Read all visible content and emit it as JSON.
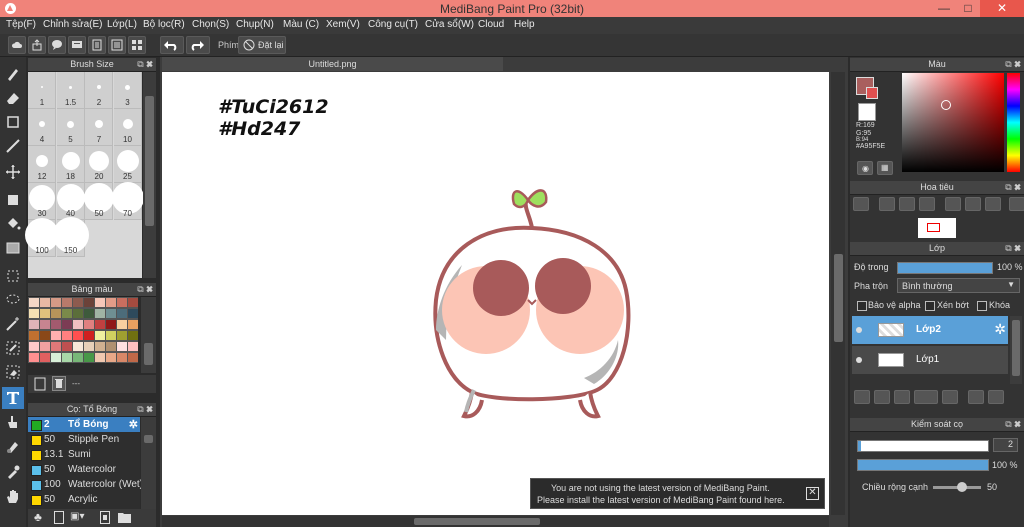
{
  "window": {
    "title": "MediBang Paint Pro (32bit)",
    "min": "—",
    "max": "□",
    "close": "✕"
  },
  "menu": [
    "Tệp(F)",
    "Chỉnh sửa(E)",
    "Lớp(L)",
    "Bộ lọc(R)",
    "Chọn(S)",
    "Chụp(N)",
    "Màu (C)",
    "Xem(V)",
    "Công cụ(T)",
    "Cửa sổ(W)",
    "Cloud",
    "Help"
  ],
  "toolbar": {
    "phim_label": "Phím",
    "reset_label": "Đặt lại"
  },
  "brush_size": {
    "title": "Brush Size",
    "sizes": [
      "1",
      "1.5",
      "2",
      "3",
      "4",
      "5",
      "7",
      "10",
      "12",
      "18",
      "20",
      "25",
      "30",
      "40",
      "50",
      "70",
      "100",
      "150"
    ]
  },
  "palette": {
    "title": "Bảng màu",
    "dash": "---"
  },
  "brushes": {
    "title": "Cọ: Tổ Bóng",
    "items": [
      {
        "size": "2",
        "name": "Tổ Bóng",
        "color": "#22aa22",
        "selected": true
      },
      {
        "size": "50",
        "name": "Stipple Pen",
        "color": "#ffd700"
      },
      {
        "size": "13.1",
        "name": "Sumi",
        "color": "#ffd700"
      },
      {
        "size": "50",
        "name": "Watercolor",
        "color": "#5bc0eb"
      },
      {
        "size": "100",
        "name": "Watercolor (Wet)",
        "color": "#5bc0eb"
      },
      {
        "size": "50",
        "name": "Acrylic",
        "color": "#ffd700"
      }
    ]
  },
  "document": {
    "tab": "Untitled.png"
  },
  "canvas_text": {
    "line1": "#TuCi2612",
    "line2": "#Hd247"
  },
  "notice": {
    "line1": "You are not using the latest version of MediBang Paint.",
    "line2": "Please install the latest version of MediBang Paint found here."
  },
  "color_panel": {
    "title": "Màu",
    "r": "R:169",
    "g": "G:95",
    "b": "B:94",
    "hex": "#A95F5E",
    "fg_color": "#A95F5E"
  },
  "navigator": {
    "title": "Hoa tiêu"
  },
  "layers": {
    "title": "Lớp",
    "opacity_label": "Độ trong",
    "opacity_value": "100 %",
    "blend_label": "Pha trộn",
    "blend_value": "Bình thường",
    "protect_alpha": "Bảo vệ alpha",
    "clipping": "Xén bớt",
    "lock": "Khóa",
    "items": [
      {
        "name": "Lớp2",
        "selected": true
      },
      {
        "name": "Lớp1"
      }
    ]
  },
  "brush_control": {
    "title": "Kiểm soát cọ",
    "size_value": "2",
    "opacity_value": "100 %",
    "edge_label": "Chiều rộng cạnh",
    "edge_value": "50",
    "edge_level": 0.6
  }
}
